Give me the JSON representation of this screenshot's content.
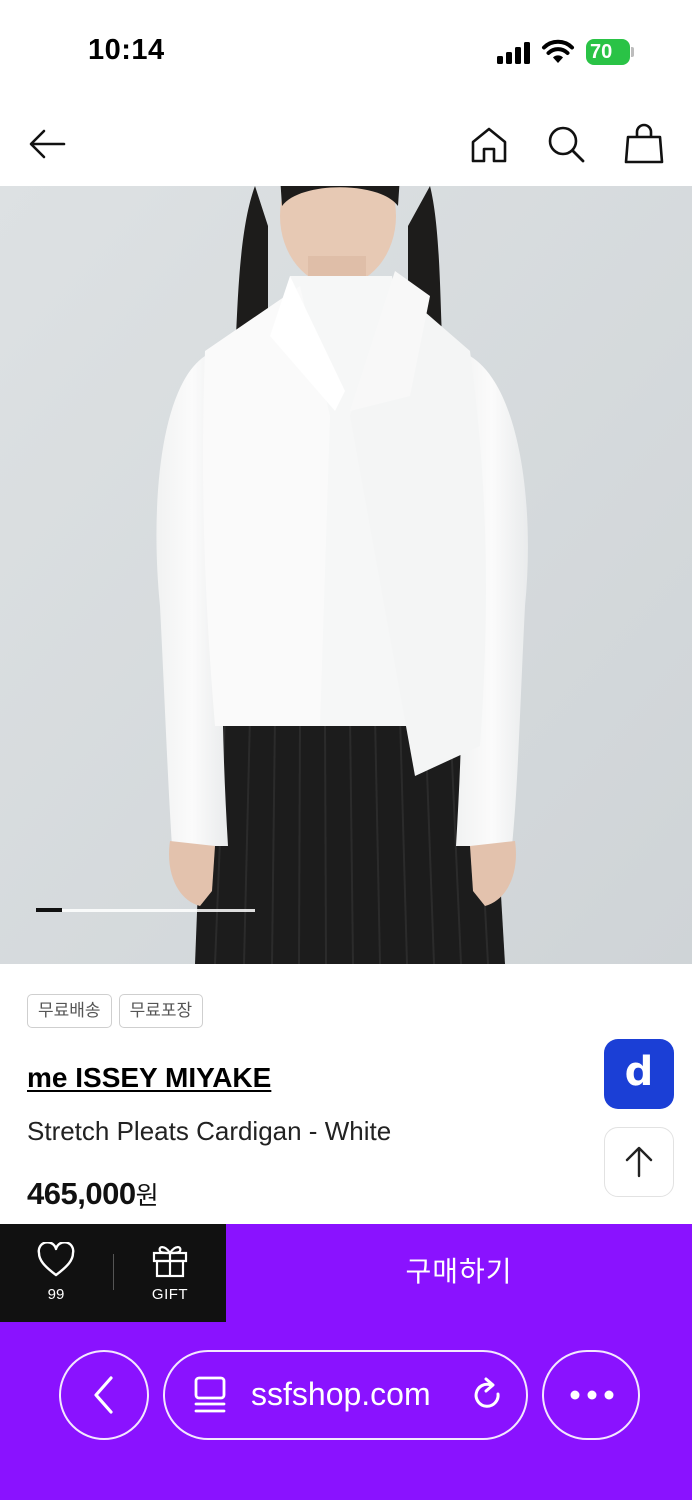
{
  "status_bar": {
    "time": "10:14",
    "battery": "70"
  },
  "header": {
    "icons": [
      "back-arrow-icon",
      "home-icon",
      "search-icon",
      "shopping-bag-icon"
    ]
  },
  "gallery": {
    "image_alt": "Model wearing white stretch pleats cardigan over white top and black pleated skirt",
    "progress": 0.12
  },
  "product": {
    "tags": [
      "무료배송",
      "무료포장"
    ],
    "brand": "me ISSEY MIYAKE",
    "name": "Stretch Pleats Cardigan - White",
    "price": "465,000",
    "price_unit": "원"
  },
  "floating": {
    "d_button_label": "d"
  },
  "action_bar": {
    "wish_count": "99",
    "gift_label": "GIFT",
    "buy_label": "구매하기"
  },
  "browser": {
    "url": "ssfshop.com"
  },
  "colors": {
    "accent": "#8a12ff",
    "d_button": "#1b3fd6",
    "action_left_bg": "#111111",
    "battery": "#2ac346"
  }
}
